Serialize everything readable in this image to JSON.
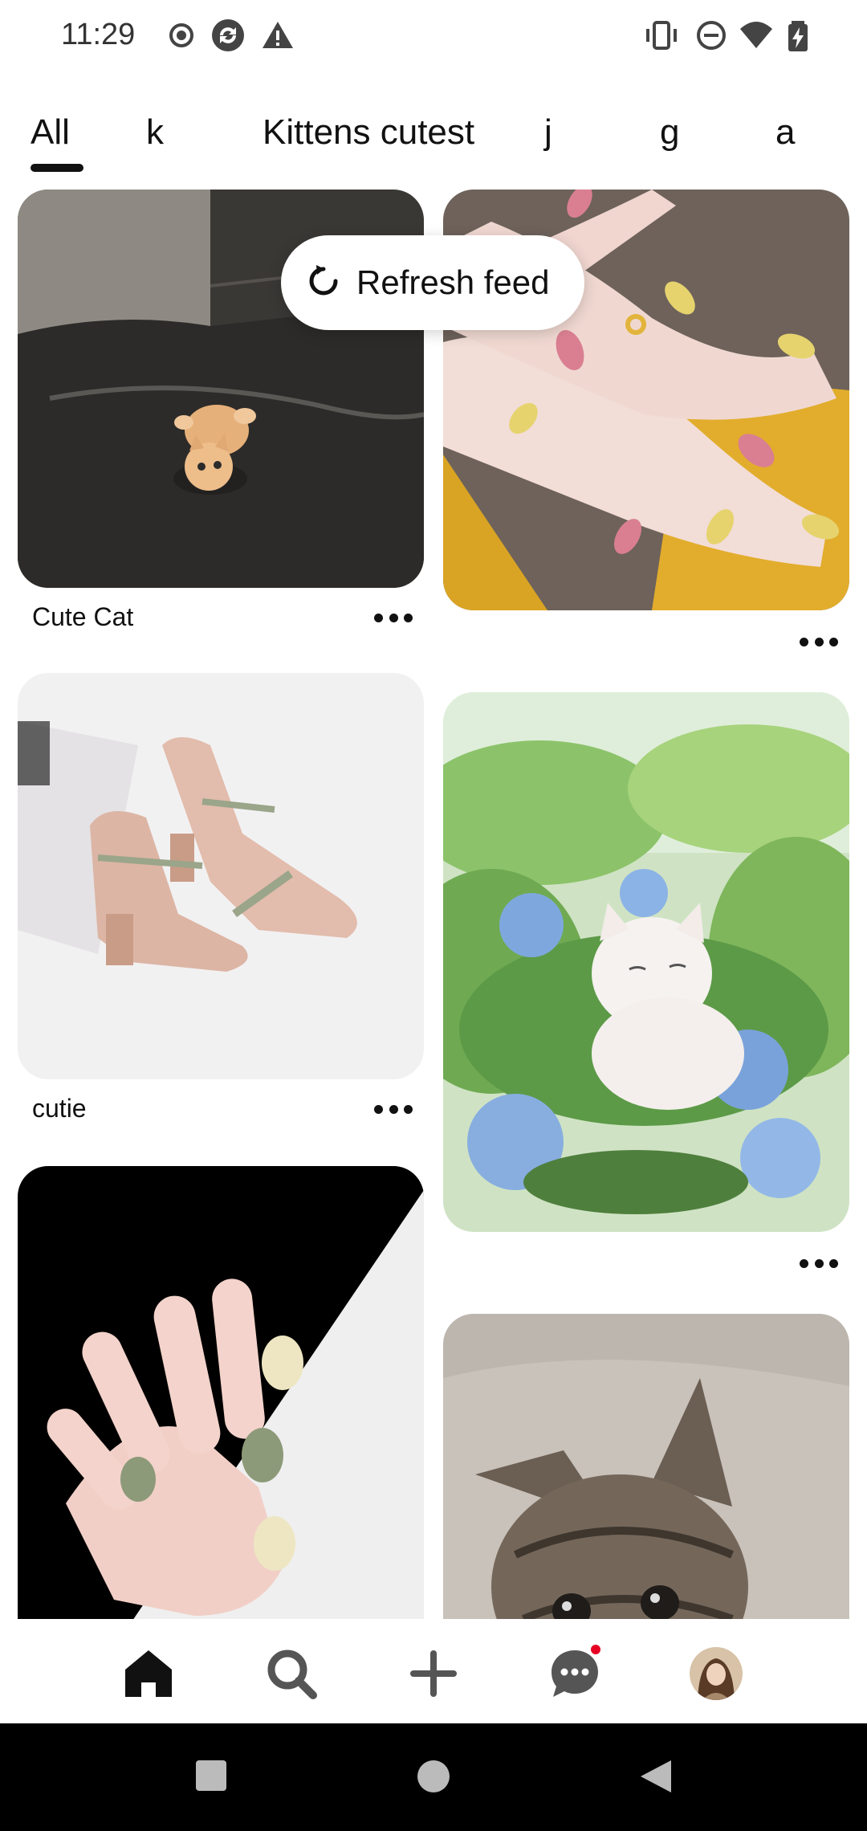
{
  "status_bar": {
    "time": "11:29",
    "left_icons": [
      "record-icon",
      "sync-icon",
      "warning-icon"
    ],
    "right_icons": [
      "vibrate-icon",
      "dnd-icon",
      "wifi-icon",
      "battery-charging-icon"
    ]
  },
  "tabs": {
    "items": [
      "All",
      "k",
      "Kittens cutest",
      "j",
      "g",
      "a"
    ],
    "active": "All"
  },
  "refresh": {
    "label": "Refresh feed"
  },
  "feed": {
    "left_column": [
      {
        "title": "Cute Cat",
        "image": "kitten-on-leather-sofa"
      },
      {
        "title": "cutie",
        "image": "pink-heel-shoes"
      },
      {
        "title": "",
        "image": "green-heart-nails"
      }
    ],
    "right_column": [
      {
        "title": "",
        "image": "pastel-manicure-hands"
      },
      {
        "title": "",
        "image": "cat-in-hydrangeas-painting"
      },
      {
        "title": "",
        "image": "tabby-kitten"
      }
    ]
  },
  "bottom_nav": {
    "items": [
      "home-icon",
      "search-icon",
      "create-icon",
      "messages-icon",
      "profile-avatar"
    ],
    "active": "home-icon",
    "messages_has_notification": true
  },
  "colors": {
    "accent": "#e60023",
    "text": "#111111",
    "background": "#ffffff"
  }
}
